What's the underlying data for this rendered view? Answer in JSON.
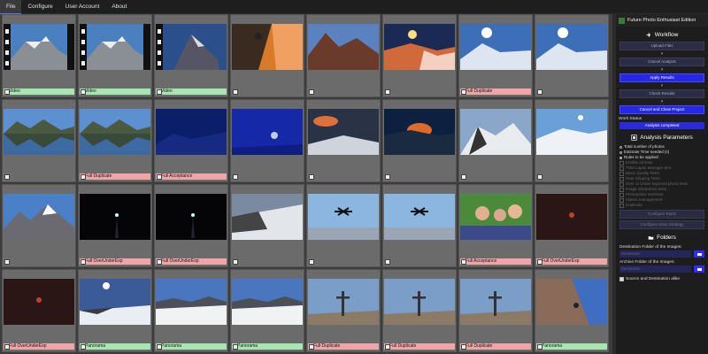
{
  "menu": {
    "items": [
      "File",
      "Configure",
      "User Account",
      "About"
    ]
  },
  "grid": {
    "cells": [
      {
        "label": "Video",
        "status": "green",
        "scene": "film-mountain"
      },
      {
        "label": "Video",
        "status": "green",
        "scene": "film-mountain"
      },
      {
        "label": "Video",
        "status": "green",
        "scene": "film-rock"
      },
      {
        "label": "",
        "status": "plain",
        "scene": "orange-climber"
      },
      {
        "label": "",
        "status": "plain",
        "scene": "sunset-peaks"
      },
      {
        "label": "",
        "status": "plain",
        "scene": "sunset-ridge"
      },
      {
        "label": "Full Duplicate",
        "status": "red",
        "scene": "sun-snow"
      },
      {
        "label": "",
        "status": "plain",
        "scene": "sun-snow"
      },
      {
        "label": "",
        "status": "plain",
        "scene": "lake-reflection"
      },
      {
        "label": "Full Duplicate",
        "status": "red",
        "scene": "lake-reflection"
      },
      {
        "label": "Full Acceptance",
        "status": "red",
        "scene": "blue-night"
      },
      {
        "label": "",
        "status": "plain",
        "scene": "blue-light"
      },
      {
        "label": "",
        "status": "plain",
        "scene": "dawn-clouds"
      },
      {
        "label": "",
        "status": "plain",
        "scene": "dawn-dark"
      },
      {
        "label": "",
        "status": "plain",
        "scene": "snow-rock"
      },
      {
        "label": "",
        "status": "plain",
        "scene": "snow-field"
      },
      {
        "label": "",
        "status": "plain",
        "scene": "blue-peaks"
      },
      {
        "label": "Full OverUnderExp",
        "status": "red",
        "scene": "night-lamp"
      },
      {
        "label": "Full OverUnderExp",
        "status": "red",
        "scene": "night-lamp"
      },
      {
        "label": "",
        "status": "plain",
        "scene": "snow-slope"
      },
      {
        "label": "",
        "status": "plain",
        "scene": "drone-sky"
      },
      {
        "label": "",
        "status": "plain",
        "scene": "drone-sky"
      },
      {
        "label": "Full Acceptance",
        "status": "red",
        "scene": "selfie-group"
      },
      {
        "label": "Full OverUnderExp",
        "status": "red",
        "scene": "dark-red"
      },
      {
        "label": "Full OverUnderExp",
        "status": "red",
        "scene": "dark-red"
      },
      {
        "label": "Panorama",
        "status": "green",
        "scene": "sun-pano"
      },
      {
        "label": "Panorama",
        "status": "green",
        "scene": "snow-pano"
      },
      {
        "label": "Panorama",
        "status": "green",
        "scene": "snow-pano"
      },
      {
        "label": "Full Duplicate",
        "status": "red",
        "scene": "summit-cross"
      },
      {
        "label": "Full Duplicate",
        "status": "red",
        "scene": "summit-cross"
      },
      {
        "label": "Full Duplicate",
        "status": "red",
        "scene": "summit-cross"
      },
      {
        "label": "Panorama",
        "status": "green",
        "scene": "rock-climber"
      }
    ]
  },
  "panel": {
    "brand": "Future Photo Enthusiast Edition",
    "workflow": {
      "title": "Workflow",
      "buttons": [
        {
          "label": "Upload Files",
          "active": false
        },
        {
          "label": "Cancel Analysis",
          "active": false
        },
        {
          "label": "Apply Results",
          "active": true
        },
        {
          "label": "Check Results",
          "active": false
        },
        {
          "label": "Cancel and Close Project",
          "active": true
        }
      ],
      "status_label": "Work Status",
      "status_value": "Analysis completed"
    },
    "analysis": {
      "title": "Analysis Parameters",
      "options": [
        {
          "label": "Total number of photos",
          "on": false,
          "dim": false,
          "kind": "radio"
        },
        {
          "label": "Estimate Time needed (s)",
          "on": false,
          "dim": false,
          "kind": "radio"
        },
        {
          "label": "Rules to be applied:",
          "on": true,
          "dim": false,
          "kind": "radio"
        },
        {
          "label": "Enable all tests",
          "dim": true,
          "kind": "check"
        },
        {
          "label": "Time Lapse Manager test",
          "dim": true,
          "kind": "check"
        },
        {
          "label": "Basic Quality Tests",
          "dim": true,
          "kind": "check"
        },
        {
          "label": "Over Clipping Tests",
          "dim": true,
          "kind": "check"
        },
        {
          "label": "Over or Under exposed photo tests",
          "dim": true,
          "kind": "check"
        },
        {
          "label": "Image Sharpness tests",
          "dim": true,
          "kind": "check"
        },
        {
          "label": "Personalize selection",
          "dim": true,
          "kind": "check"
        },
        {
          "label": "Videos management",
          "dim": true,
          "kind": "check"
        },
        {
          "label": "Duplicate",
          "dim": true,
          "kind": "check"
        }
      ],
      "buttons": [
        "Configure Rules",
        "Configure Save Strategy"
      ]
    },
    "folders": {
      "title": "Folders",
      "destination_label": "Destination Folder of the Images:",
      "destination_placeholder": "Destination",
      "archive_label": "Archive Folder of the Images:",
      "archive_placeholder": "Destination",
      "same_label": "Source and Destination alike"
    }
  }
}
